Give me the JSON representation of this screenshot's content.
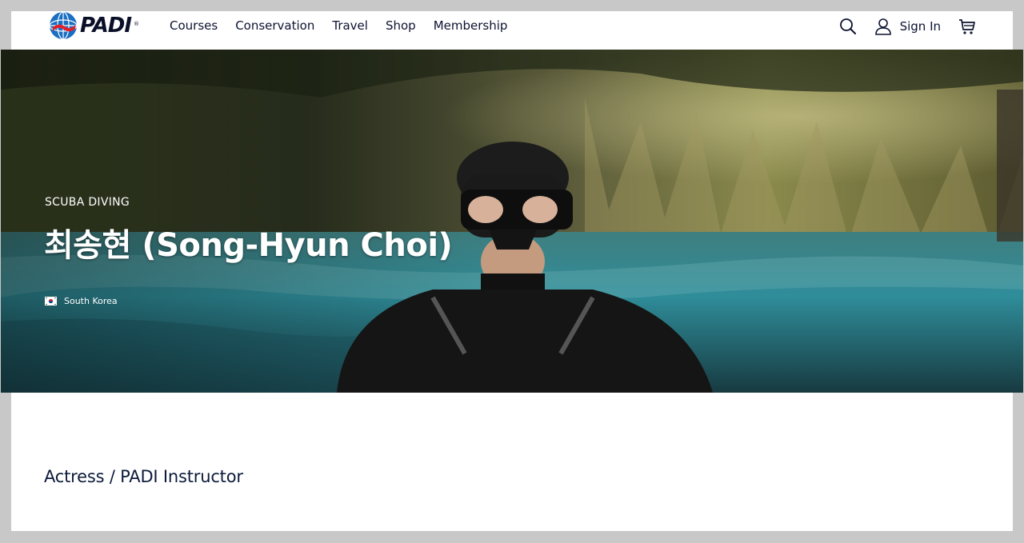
{
  "brand": {
    "name": "PADI",
    "trademark": "®"
  },
  "nav": {
    "items": [
      {
        "label": "Courses"
      },
      {
        "label": "Conservation"
      },
      {
        "label": "Travel"
      },
      {
        "label": "Shop"
      },
      {
        "label": "Membership"
      }
    ]
  },
  "tools": {
    "search_icon": "search-icon",
    "signin_label": "Sign In",
    "user_icon": "user-icon",
    "cart_icon": "cart-icon"
  },
  "hero": {
    "kicker": "SCUBA DIVING",
    "title": "최송현 (Song-Hyun Choi)",
    "country": "South Korea",
    "flag_icon": "south-korea-flag-icon"
  },
  "profile": {
    "subtitle": "Actress / PADI Instructor"
  },
  "colors": {
    "text_dark": "#0c1230",
    "hero_text": "#ffffff",
    "background": "#c8c8c8"
  }
}
